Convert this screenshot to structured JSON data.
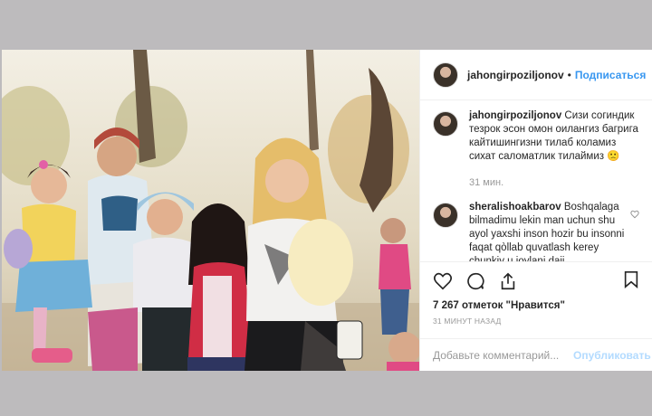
{
  "post": {
    "username": "jahongirpoziljonov",
    "separator": "•",
    "follow_label": "Подписаться",
    "caption": {
      "username": "jahongirpoziljonov",
      "text": "Сизи согиндик тезрок эсон омон оилангиз багрига кайтишингизни тилаб коламиз сихат саломатлик тилаймиз 🙁",
      "time": "31 мин."
    },
    "comment": {
      "username": "sheralishoakbarov",
      "text": "Boshqalaga bilmadimu lekin man uchun shu ayol yaxshi inson hozir bu insonni faqat qòllab quvatlash kerey chunkiy u joylani daji"
    },
    "likes": "7 267 отметок \"Нравится\"",
    "time_ago": "31 МИНУТ НАЗАД",
    "comment_input": {
      "placeholder": "Добавьте комментарий..."
    },
    "publish_label": "Опубликовать"
  },
  "icons": [
    "heart-icon",
    "comment-icon",
    "share-icon",
    "bookmark-icon",
    "small-heart-icon"
  ],
  "colors": {
    "link": "#3897f0",
    "background": "#bdbbbd",
    "muted": "#999999",
    "publish_disabled": "#b3dbff"
  }
}
